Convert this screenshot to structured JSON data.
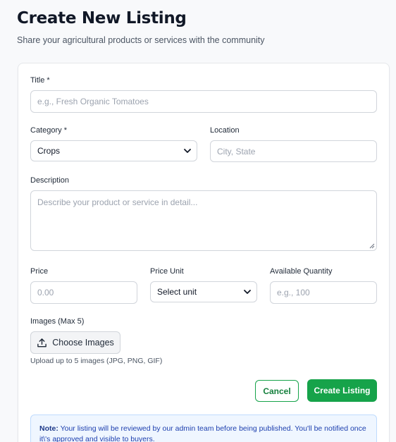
{
  "header": {
    "title": "Create New Listing",
    "subtitle": "Share your agricultural products or services with the community"
  },
  "form": {
    "title": {
      "label": "Title *",
      "placeholder": "e.g., Fresh Organic Tomatoes",
      "value": ""
    },
    "category": {
      "label": "Category *",
      "value": "Crops",
      "options": [
        "Crops"
      ]
    },
    "location": {
      "label": "Location",
      "placeholder": "City, State",
      "value": ""
    },
    "description": {
      "label": "Description",
      "placeholder": "Describe your product or service in detail...",
      "value": ""
    },
    "price": {
      "label": "Price",
      "placeholder": "0.00",
      "value": ""
    },
    "price_unit": {
      "label": "Price Unit",
      "value": "Select unit",
      "options": [
        "Select unit"
      ]
    },
    "quantity": {
      "label": "Available Quantity",
      "placeholder": "e.g., 100",
      "value": ""
    },
    "images": {
      "label": "Images (Max 5)",
      "button_label": "Choose Images",
      "button_icon": "upload-icon",
      "help": "Upload up to 5 images (JPG, PNG, GIF)"
    }
  },
  "actions": {
    "cancel_label": "Cancel",
    "create_label": "Create Listing"
  },
  "note": {
    "prefix": "Note:",
    "text": " Your listing will be reviewed by our admin team before being published. You'll be notified once it\\'s approved and visible to buyers."
  },
  "colors": {
    "primary": "#16a34a",
    "note_bg": "#eff6ff",
    "note_text": "#1e40af"
  }
}
